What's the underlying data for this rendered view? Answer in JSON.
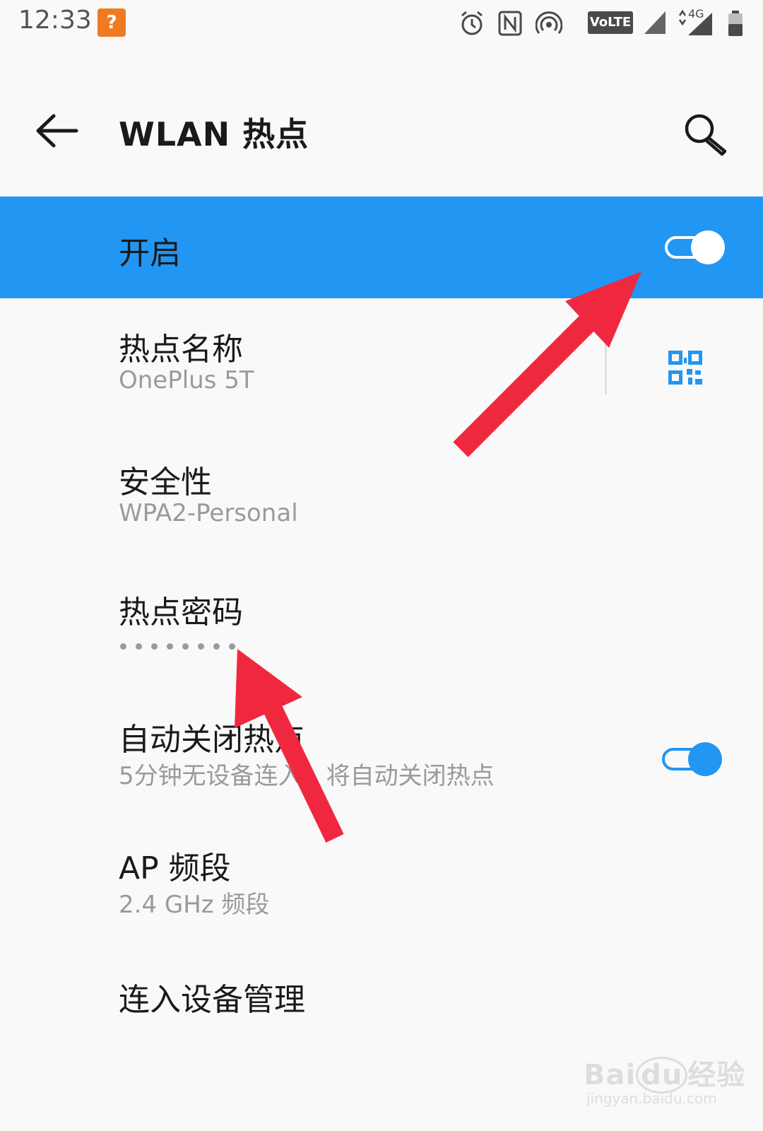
{
  "status_bar": {
    "time": "12:33",
    "network_badge": "VoLTE",
    "network_type": "4G",
    "icons": [
      "app-notification-icon",
      "alarm-icon",
      "nfc-icon",
      "hotspot-icon",
      "volte-icon",
      "signal-icon",
      "signal-4g-icon",
      "battery-icon"
    ]
  },
  "header": {
    "title": "WLAN 热点",
    "back_icon": "arrow-left-icon",
    "search_icon": "search-icon"
  },
  "master_toggle": {
    "label": "开启",
    "enabled": true,
    "color": "#2196f3"
  },
  "settings": {
    "hotspot_name": {
      "title": "热点名称",
      "value": "OnePlus 5T",
      "qr_icon": "qr-code-icon"
    },
    "security": {
      "title": "安全性",
      "value": "WPA2-Personal"
    },
    "password": {
      "title": "热点密码",
      "masked_length": 8
    },
    "auto_off": {
      "title": "自动关闭热点",
      "subtitle": "5分钟无设备连入，将自动关闭热点",
      "enabled": true
    },
    "ap_band": {
      "title": "AP 频段",
      "value": "2.4 GHz 频段"
    },
    "device_management": {
      "title": "连入设备管理"
    }
  },
  "accent_color": "#2196f3",
  "annotation_color": "#f0283f",
  "watermark": {
    "brand": "Baidu经验",
    "url": "jingyan.baidu.com"
  }
}
